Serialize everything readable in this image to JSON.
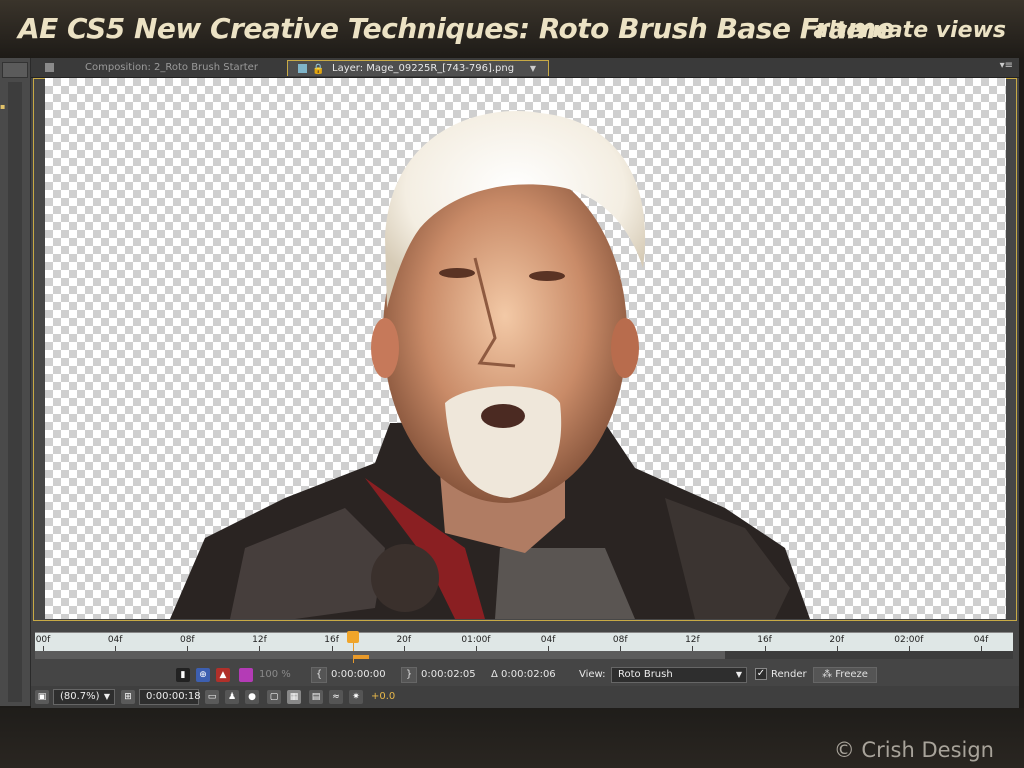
{
  "header": {
    "title": "AE CS5 New Creative Techniques: Roto Brush Base Frame",
    "subtitle": "alternate views"
  },
  "tabs": {
    "composition": "Composition: 2_Roto Brush Starter",
    "layer": "Layer: Mage_09225R_[743-796].png"
  },
  "timeline": {
    "ticks": [
      "00f",
      "04f",
      "08f",
      "12f",
      "16f",
      "20f",
      "01:00f",
      "04f",
      "08f",
      "12f",
      "16f",
      "20f",
      "02:00f",
      "04f"
    ],
    "current_frame_fraction": 0.33
  },
  "controls": {
    "opacity": "100 %",
    "in_point": "0:00:00:00",
    "out_point": "0:00:02:05",
    "duration": "Δ 0:00:02:06",
    "view_label": "View:",
    "view_value": "Roto Brush",
    "render_label": "Render",
    "render_checked": true,
    "freeze_label": "Freeze",
    "zoom": "(80.7%)",
    "timecode": "0:00:00:18",
    "exposure": "+0.0"
  },
  "credit": "© Crish Design",
  "colors": {
    "accent_orange": "#e89a2a",
    "panel_border": "#c8aa45",
    "title_text": "#ece2c4"
  }
}
